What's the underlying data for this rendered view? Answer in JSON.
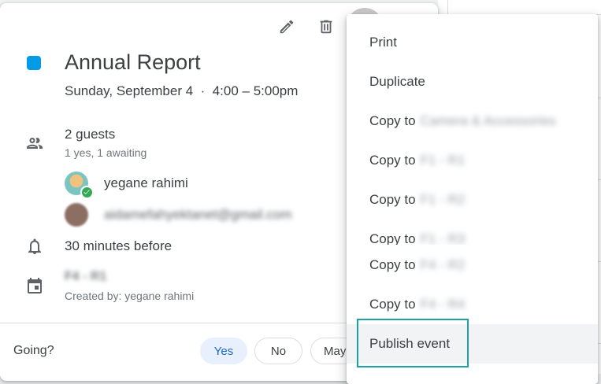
{
  "toolbar": {
    "edit_icon": "pencil-icon",
    "delete_icon": "trash-icon"
  },
  "event": {
    "color": "#039be5",
    "title": "Annual Report",
    "date_time": "Sunday, September 4  ·  4:00 – 5:00pm"
  },
  "guests": {
    "summary": "2 guests",
    "status": "1 yes, 1 awaiting",
    "list": [
      {
        "name": "yegane rahimi",
        "accepted": true
      },
      {
        "name": "aidamefahyektanet@gmail.com",
        "accepted": false
      }
    ]
  },
  "reminder": "30 minutes before",
  "calendar": {
    "name": "F4 - R1",
    "created_by": "Created by: yegane rahimi"
  },
  "rsvp": {
    "prompt": "Going?",
    "yes": "Yes",
    "no": "No",
    "maybe": "May"
  },
  "menu": {
    "items": [
      {
        "label": "Print",
        "target": ""
      },
      {
        "label": "Duplicate",
        "target": ""
      },
      {
        "label": "Copy to",
        "target": "Camera & Accessories"
      },
      {
        "label": "Copy to",
        "target": "F1 - R1"
      },
      {
        "label": "Copy to",
        "target": "F1 - R2"
      },
      {
        "label": "Copy to",
        "target": "F1 - R3"
      },
      {
        "label": "Copy to",
        "target": "F4 - R2"
      },
      {
        "label": "Copy to",
        "target": "F4 - R4"
      },
      {
        "label": "Publish event",
        "target": ""
      }
    ],
    "highlighted": "Publish event",
    "highlight_color": "#1da1a8"
  }
}
